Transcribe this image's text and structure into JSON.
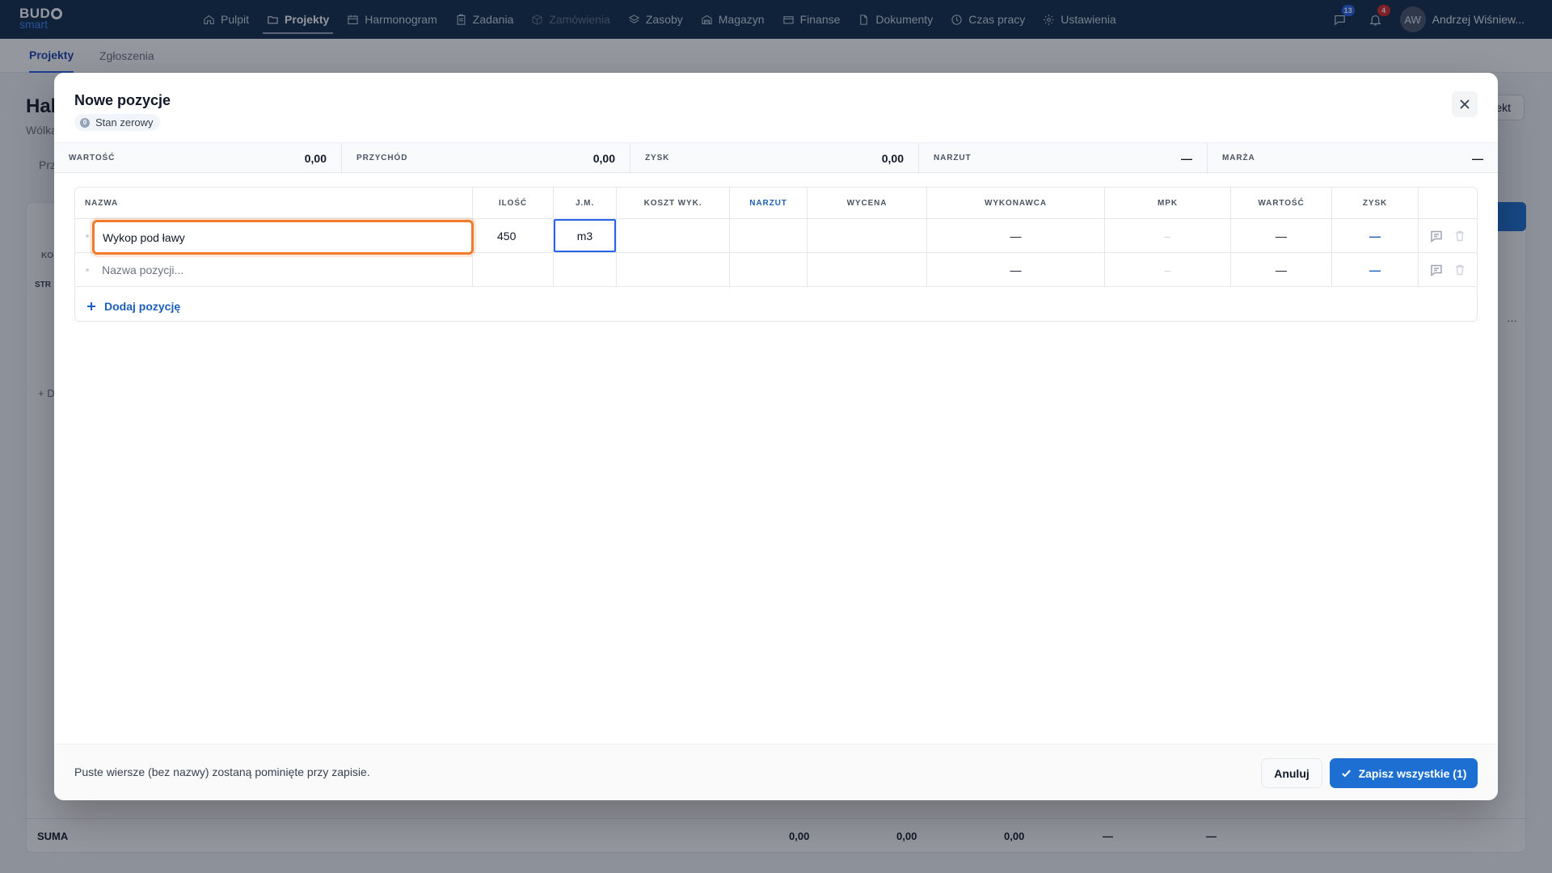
{
  "brand": {
    "line1": "BUD",
    "line2": "smart"
  },
  "nav": [
    {
      "label": "Pulpit",
      "icon": "home-icon",
      "active": false,
      "disabled": false
    },
    {
      "label": "Projekty",
      "icon": "folder-icon",
      "active": true,
      "disabled": false
    },
    {
      "label": "Harmonogram",
      "icon": "calendar-icon",
      "active": false,
      "disabled": false
    },
    {
      "label": "Zadania",
      "icon": "clipboard-icon",
      "active": false,
      "disabled": false
    },
    {
      "label": "Zamówienia",
      "icon": "box-icon",
      "active": false,
      "disabled": true
    },
    {
      "label": "Zasoby",
      "icon": "layers-icon",
      "active": false,
      "disabled": false
    },
    {
      "label": "Magazyn",
      "icon": "warehouse-icon",
      "active": false,
      "disabled": false
    },
    {
      "label": "Finanse",
      "icon": "wallet-icon",
      "active": false,
      "disabled": false
    },
    {
      "label": "Dokumenty",
      "icon": "document-icon",
      "active": false,
      "disabled": false
    },
    {
      "label": "Czas pracy",
      "icon": "clock-icon",
      "active": false,
      "disabled": false
    },
    {
      "label": "Ustawienia",
      "icon": "gear-icon",
      "active": false,
      "disabled": false
    }
  ],
  "top_right": {
    "messages_count": "13",
    "notifications_count": "4",
    "user_initials": "AW",
    "user_name": "Andrzej Wiśniew..."
  },
  "subnav": {
    "tab1": "Projekty",
    "tab2": "Zgłoszenia"
  },
  "background": {
    "title": "Hal",
    "subtitle": "Wólka",
    "tab": "Prz",
    "button": "ekt",
    "col_short": "KO",
    "row_short": "STR",
    "add_short": "+ D",
    "ellipsis": "···",
    "sum": {
      "label": "SUMA",
      "v1": "0,00",
      "v2": "0,00",
      "v3": "0,00",
      "v4": "—",
      "v5": "—"
    }
  },
  "modal": {
    "title": "Nowe pozycje",
    "chip_badge": "0",
    "chip_label": "Stan zerowy",
    "summary": [
      {
        "label": "WARTOŚĆ",
        "value": "0,00"
      },
      {
        "label": "PRZYCHÓD",
        "value": "0,00"
      },
      {
        "label": "ZYSK",
        "value": "0,00"
      },
      {
        "label": "NARZUT",
        "value": "—"
      },
      {
        "label": "MARŻA",
        "value": "—"
      }
    ],
    "columns": [
      "NAZWA",
      "ILOŚĆ",
      "J.M.",
      "KOSZT WYK.",
      "NARZUT",
      "WYCENA",
      "WYKONAWCA",
      "MPK",
      "WARTOŚĆ",
      "ZYSK"
    ],
    "rows": [
      {
        "name": "Wykop pod ławy",
        "qty": "450",
        "unit": "m3",
        "contractor": "—",
        "mpk": "–",
        "value": "—",
        "profit": "—"
      },
      {
        "name_placeholder": "Nazwa pozycji...",
        "contractor": "—",
        "mpk": "–",
        "value": "—",
        "profit": "—"
      }
    ],
    "add_label": "Dodaj pozycję",
    "footer_note": "Puste wiersze (bez nazwy) zostaną pominięte przy zapisie.",
    "cancel_label": "Anuluj",
    "save_label": "Zapisz wszystkie (1)"
  },
  "colors": {
    "nav_bg": "#0f2a47",
    "accent": "#1d6fd1",
    "focus_outline": "#f07a2e"
  }
}
